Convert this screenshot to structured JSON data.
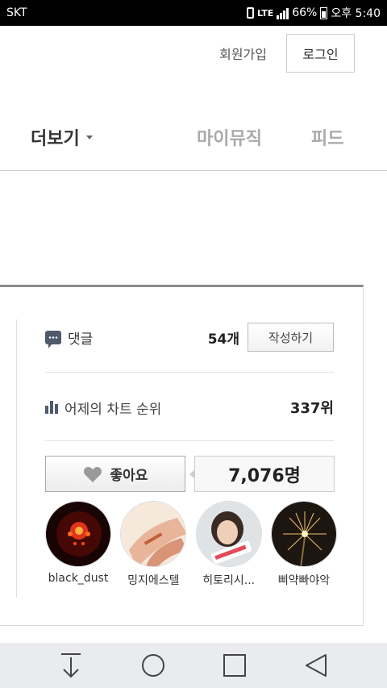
{
  "status_bar": {
    "carrier": "SKT",
    "battery": "66%",
    "time": "오후 5:40",
    "icons": [
      "vibrate-icon",
      "lte-icon",
      "signal-icon",
      "battery-icon"
    ]
  },
  "auth": {
    "join_label": "회원가입",
    "login_label": "로그인"
  },
  "nav": {
    "more_label": "더보기",
    "mymusic_label": "마이뮤직",
    "feed_label": "피드"
  },
  "comment": {
    "label": "댓글",
    "count": "54개",
    "write_label": "작성하기"
  },
  "rank": {
    "label": "어제의 차트 순위",
    "value": "337위"
  },
  "like": {
    "label": "좋아요",
    "count": "7,076명"
  },
  "likers": [
    {
      "name": "black_dust"
    },
    {
      "name": "밍지에스텔"
    },
    {
      "name": "히토리시..."
    },
    {
      "name": "삐약빠야악"
    }
  ],
  "colors": {
    "accent_icon": "#4f5a6a",
    "card_top_border": "#8a8a8a",
    "navbar_bg": "#e9ebef"
  }
}
